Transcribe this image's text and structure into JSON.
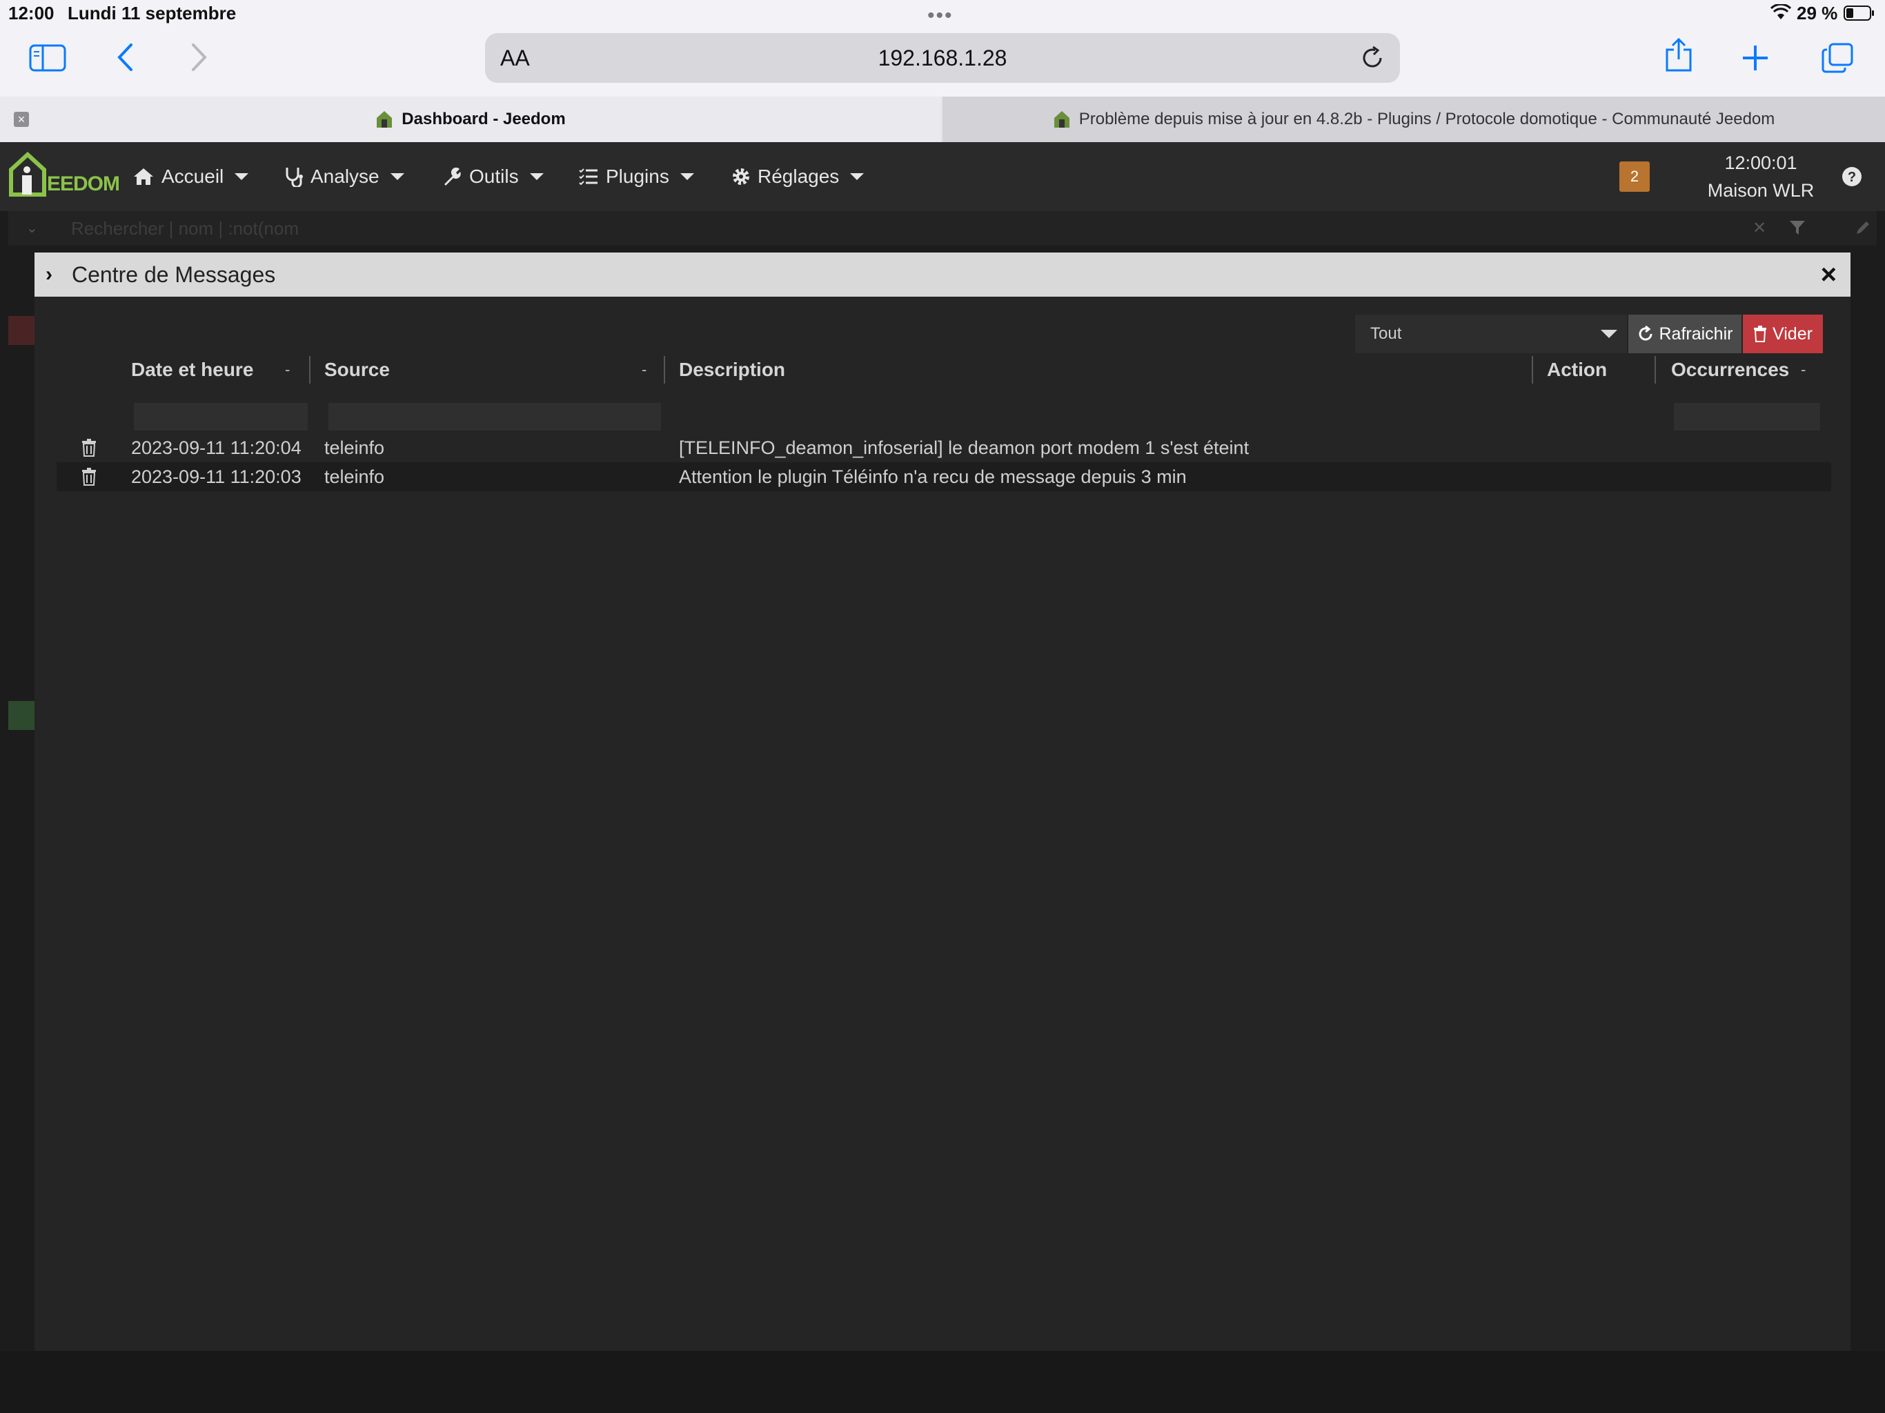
{
  "status_bar": {
    "time": "12:00",
    "date": "Lundi 11 septembre",
    "battery": "29 %"
  },
  "browser": {
    "url": "192.168.1.28",
    "text_size_label": "AA",
    "tabs": [
      {
        "label": "Dashboard - Jeedom",
        "active": true
      },
      {
        "label": "Problème depuis mise à jour en 4.8.2b - Plugins / Protocole domotique - Communauté Jeedom",
        "active": false
      }
    ]
  },
  "navbar": {
    "logo_text": "EEDOM",
    "menu": [
      {
        "label": "Accueil",
        "icon": "home-icon"
      },
      {
        "label": "Analyse",
        "icon": "stethoscope-icon"
      },
      {
        "label": "Outils",
        "icon": "wrench-icon"
      },
      {
        "label": "Plugins",
        "icon": "list-icon"
      },
      {
        "label": "Réglages",
        "icon": "gear-icon"
      }
    ],
    "message_count": "2",
    "clock_time": "12:00:01",
    "house_name": "Maison WLR"
  },
  "search": {
    "placeholder": "Rechercher | nom | :not(nom"
  },
  "modal": {
    "title": "Centre de Messages",
    "filter_value": "Tout",
    "refresh_label": "Rafraichir",
    "clear_label": "Vider",
    "columns": {
      "date": "Date et heure",
      "source": "Source",
      "description": "Description",
      "action": "Action",
      "occurrences": "Occurrences",
      "sort_marker": "-"
    },
    "rows": [
      {
        "date": "2023-09-11 11:20:04",
        "source": "teleinfo",
        "description": "[TELEINFO_deamon_infoserial] le deamon port modem 1 s'est éteint"
      },
      {
        "date": "2023-09-11 11:20:03",
        "source": "teleinfo",
        "description": "Attention le plugin Téléinfo n'a recu de message depuis 3 min"
      }
    ]
  },
  "colors": {
    "navbar_bg": "#2a2a2a",
    "modal_bg": "#252525",
    "badge": "#b9742f",
    "danger": "#c0393e",
    "ios_blue": "#0a7aff",
    "logo_green": "#8bc34a"
  }
}
